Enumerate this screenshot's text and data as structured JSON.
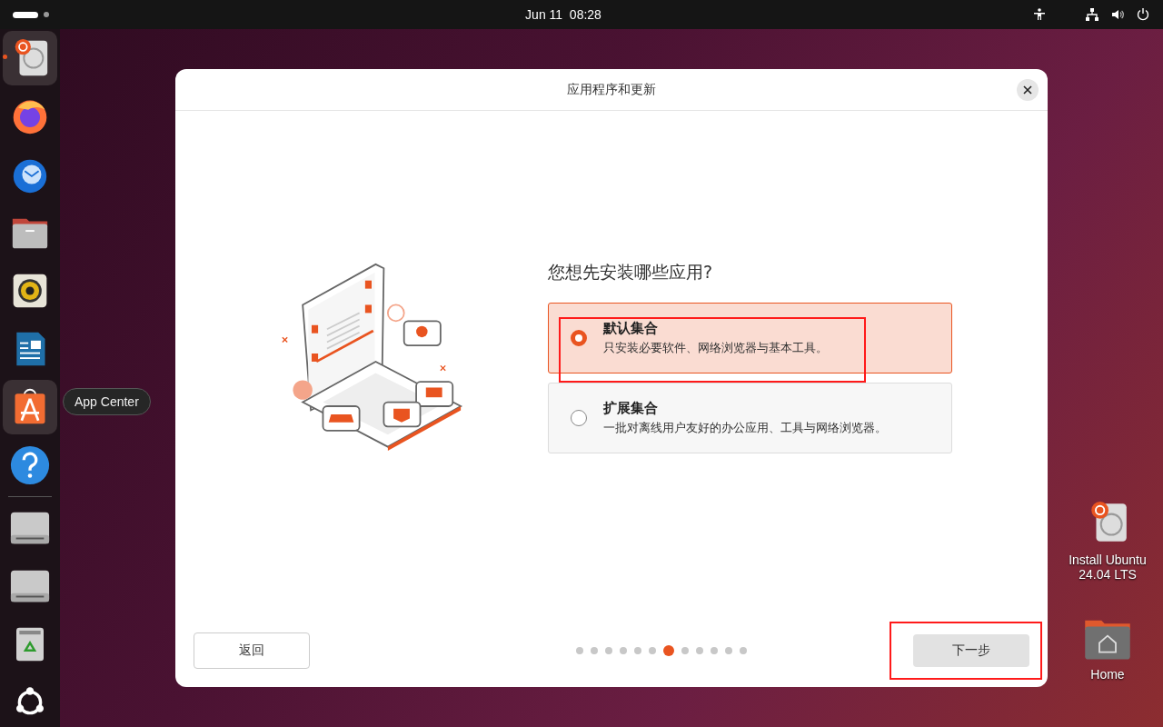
{
  "top_bar": {
    "clock": "Jun 11  08:28"
  },
  "dock": {
    "items": [
      {
        "kind": "installer",
        "selected": true,
        "running": true
      },
      {
        "kind": "firefox",
        "selected": false,
        "running": false
      },
      {
        "kind": "thunderbird",
        "selected": false,
        "running": false
      },
      {
        "kind": "files",
        "selected": false,
        "running": false
      },
      {
        "kind": "rhythmbox",
        "selected": false,
        "running": false
      },
      {
        "kind": "writer",
        "selected": false,
        "running": false
      },
      {
        "kind": "appcenter",
        "selected": true,
        "running": false
      },
      {
        "kind": "help",
        "selected": false,
        "running": false
      },
      {
        "kind": "separator"
      },
      {
        "kind": "drive",
        "selected": false,
        "running": false
      },
      {
        "kind": "drive",
        "selected": false,
        "running": false
      },
      {
        "kind": "trash",
        "selected": false,
        "running": false
      },
      {
        "kind": "apps",
        "selected": false,
        "running": false
      }
    ],
    "tooltip": "App Center"
  },
  "dialog": {
    "title": "应用程序和更新",
    "question": "您想先安装哪些应用?",
    "options": [
      {
        "title": "默认集合",
        "description": "只安装必要软件、网络浏览器与基本工具。",
        "selected": true
      },
      {
        "title": "扩展集合",
        "description": "一批对离线用户友好的办公应用、工具与网络浏览器。",
        "selected": false
      }
    ],
    "back_button": "返回",
    "next_button": "下一步",
    "steps": [
      {
        "selected": false
      },
      {
        "selected": false
      },
      {
        "selected": false
      },
      {
        "selected": false
      },
      {
        "selected": false
      },
      {
        "selected": false
      },
      {
        "selected": true
      },
      {
        "selected": false
      },
      {
        "selected": false
      },
      {
        "selected": false
      },
      {
        "selected": false
      },
      {
        "selected": false
      }
    ]
  },
  "desktop_icons": [
    {
      "kind": "installer",
      "label": "Install Ubuntu 24.04 LTS"
    },
    {
      "kind": "home",
      "label": "Home"
    }
  ]
}
